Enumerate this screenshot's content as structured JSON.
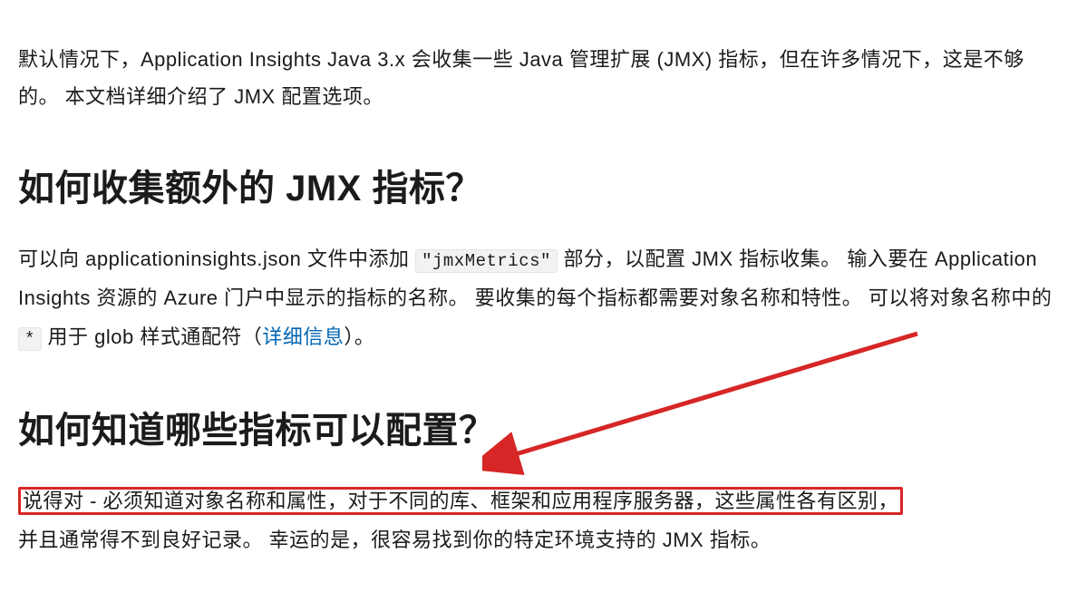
{
  "intro": {
    "text": "默认情况下，Application Insights Java 3.x 会收集一些 Java 管理扩展 (JMX) 指标，但在许多情况下，这是不够的。 本文档详细介绍了 JMX 配置选项。"
  },
  "h1": "如何收集额外的 JMX 指标？",
  "para1": {
    "before_code1": "可以向 applicationinsights.json 文件中添加 ",
    "code1": "\"jmxMetrics\"",
    "after_code1_before_code2": " 部分，以配置 JMX 指标收集。 输入要在 Application Insights 资源的 Azure 门户中显示的指标的名称。 要收集的每个指标都需要对象名称和特性。 可以将对象名称中的 ",
    "code2": "*",
    "after_code2_before_link": " 用于 glob 样式通配符（",
    "link_text": "详细信息",
    "after_link": "）。"
  },
  "h2": "如何知道哪些指标可以配置？",
  "para2": {
    "highlighted": "说得对 - 必须知道对象名称和属性，对于不同的库、框架和应用程序服务器，这些属性各有区别，",
    "rest": "并且通常得不到良好记录。 幸运的是，很容易找到你的特定环境支持的 JMX 指标。"
  }
}
